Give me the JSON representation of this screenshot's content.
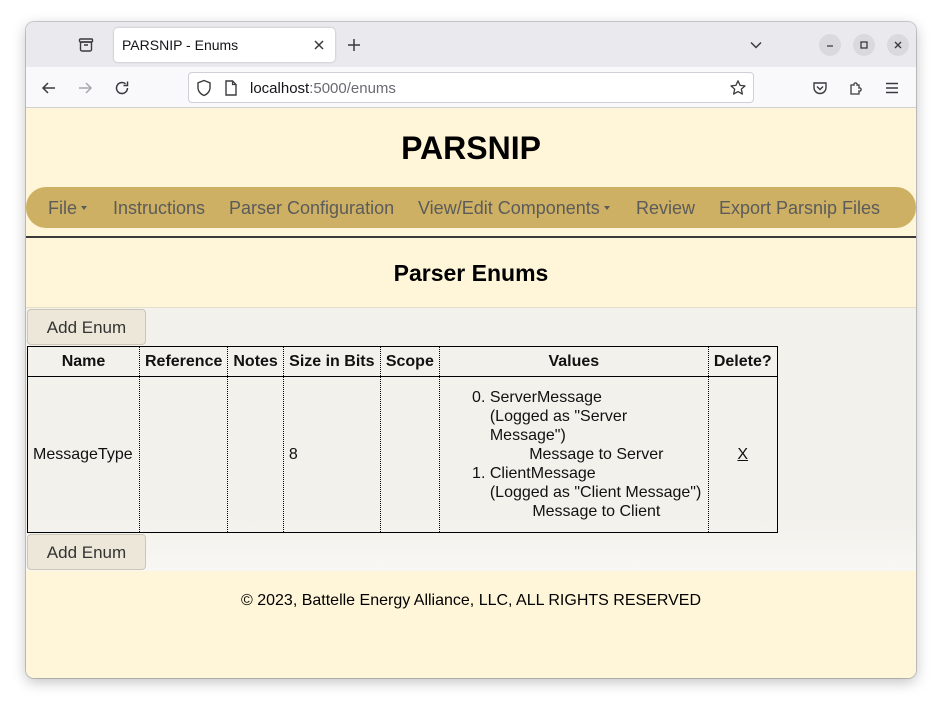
{
  "browser": {
    "tab_title": "PARSNIP - Enums",
    "url_host": "localhost",
    "url_path": ":5000/enums"
  },
  "site": {
    "title": "PARSNIP"
  },
  "menu": {
    "items": [
      {
        "label": "File",
        "dropdown": true
      },
      {
        "label": "Instructions",
        "dropdown": false
      },
      {
        "label": "Parser Configuration",
        "dropdown": false
      },
      {
        "label": "View/Edit Components",
        "dropdown": true
      },
      {
        "label": "Review",
        "dropdown": false
      },
      {
        "label": "Export Parsnip Files",
        "dropdown": false
      }
    ]
  },
  "page": {
    "section_title": "Parser Enums",
    "add_button_label": "Add Enum",
    "footer": "© 2023, Battelle Energy Alliance, LLC, ALL RIGHTS RESERVED"
  },
  "table": {
    "headers": [
      "Name",
      "Reference",
      "Notes",
      "Size in Bits",
      "Scope",
      "Values",
      "Delete?"
    ],
    "rows": [
      {
        "name": "MessageType",
        "reference": "",
        "notes": "",
        "size_bits": "8",
        "scope": "",
        "values": [
          {
            "name": "ServerMessage",
            "logged": "(Logged as \"Server Message\")",
            "note": "Message to Server"
          },
          {
            "name": "ClientMessage",
            "logged": "(Logged as \"Client Message\")",
            "note": "Message to Client"
          }
        ],
        "delete_label": "X"
      }
    ]
  },
  "colors": {
    "page_bg": "#fff5d8",
    "menu_bg": "#cdb063",
    "content_bg": "#f3f1ec"
  }
}
